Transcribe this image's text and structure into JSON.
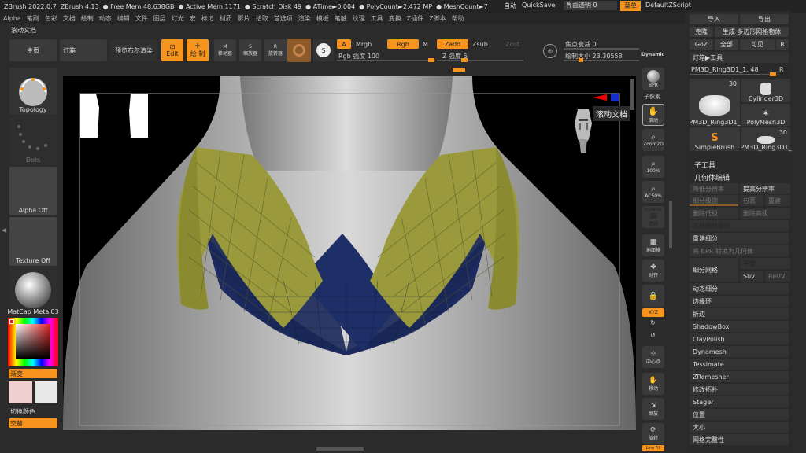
{
  "titlebar": {
    "items": [
      "ZBrush 2022.0.7",
      "ZBrush 4.13",
      "● Free Mem 48.638GB",
      "● Active Mem 1171",
      "● Scratch Disk 49",
      "● ATime►0.004",
      "● PolyCount►2.472 MP",
      "● MeshCount►7"
    ],
    "auto": "自动",
    "quicksave": "QuickSave",
    "ui_transparency": "界面透明 0",
    "menu": "菜单",
    "script": "DefaultZScript"
  },
  "menubar": [
    "Alpha",
    "笔刷",
    "色彩",
    "文档",
    "绘制",
    "动态",
    "编辑",
    "文件",
    "图层",
    "灯光",
    "宏",
    "标记",
    "材质",
    "影片",
    "拾取",
    "首选项",
    "渲染",
    "模板",
    "笔触",
    "纹理",
    "工具",
    "变换",
    "Z插件",
    "Z脚本",
    "帮助"
  ],
  "scroll_doc": "滚动文档",
  "toolbar": {
    "home": "主页",
    "lightbox": "灯箱",
    "preview_bool": "预览布尔渲染",
    "edit": "Edit",
    "draw": "绘 制",
    "move": "移动器",
    "scale": "缩放器",
    "rotate": "旋转器",
    "a": "A",
    "mrgb": "Mrgb",
    "rgb": "Rgb",
    "m": "M",
    "zadd": "Zadd",
    "zsub": "Zsub",
    "zcut": "Zcut",
    "rgb_intensity": "Rgb 强度 100",
    "z_intensity": "Z 强度 6",
    "focal_shift": "焦点衰减 0",
    "draw_size": "绘制大小 23.30558",
    "dynamic": "Dynamic"
  },
  "left": {
    "topology": "Topology",
    "dots": "Dots",
    "alpha": "Alpha Off",
    "texture": "Texture Off",
    "matcap": "MatCap Metal03",
    "gradient": "渐变",
    "switch_color": "切换颜色",
    "alternate": "交替"
  },
  "viewport": {
    "tooltip": "滚动文档"
  },
  "right_icons": [
    "BPR",
    "子像素",
    "滚动",
    "Zoom2D",
    "100%",
    "AC50%",
    "Dynamic",
    "透视",
    "地面格",
    "对齐",
    "",
    "XYZ",
    "",
    "",
    "中心点",
    "移动",
    "缩放",
    "旋转",
    "Line Fill"
  ],
  "tool_panel": {
    "row1": [
      "导入",
      "导出"
    ],
    "row2": [
      "克隆",
      "生成 多边形网格物体"
    ],
    "row3": [
      "GoZ",
      "全部",
      "可见",
      "R"
    ],
    "lightbox_tool": "灯箱▶工具",
    "current": "PM3D_Ring3D1_1. 48",
    "r": "R",
    "thumbs": [
      {
        "label": "PM3D_Ring3D1_",
        "count": "30"
      },
      {
        "label": "Cylinder3D"
      },
      {
        "label": "PolyMesh3D"
      },
      {
        "label": "SimpleBrush"
      },
      {
        "label": "PM3D_Ring3D1_",
        "count": "30"
      }
    ],
    "subtool": "子工具",
    "geometry": "几何体编辑",
    "lower": "降低分辨率",
    "higher": "提高分辨率",
    "subdiv_level": "细分级别",
    "cage": "包裹",
    "reconstruct": "重建",
    "del_lower": "删除低级",
    "del_higher": "删除高级",
    "freeze": "冻结细分级别",
    "resubdiv": "重建细分",
    "bpr_to_geo": "将 BPR 转换为几何体",
    "divide": "细分网格",
    "smooth": "平滑",
    "suv": "Suv",
    "reuv": "ReUV",
    "items": [
      "动态细分",
      "边缘环",
      "折边",
      "ShadowBox",
      "ClayPolish",
      "Dynamesh",
      "Tessimate",
      "ZRemesher",
      "修改拓扑",
      "Stager",
      "位置",
      "大小",
      "网格完整性"
    ]
  },
  "colors": {
    "accent": "#f7941d",
    "mesh_yellow": "#9a9a3c",
    "mesh_blue": "#1c2a60"
  }
}
